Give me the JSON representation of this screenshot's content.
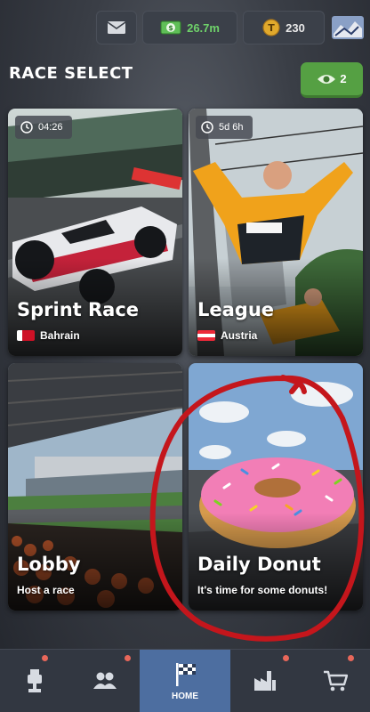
{
  "topbar": {
    "money": "26.7m",
    "gold": "230"
  },
  "header": {
    "title": "RACE SELECT",
    "viewers": "2"
  },
  "cards": [
    {
      "title": "Sprint Race",
      "subtitle": "Bahrain",
      "timer": "04:26"
    },
    {
      "title": "League",
      "subtitle": "Austria",
      "timer": "5d 6h"
    },
    {
      "title": "Lobby",
      "subtitle": "Host a race"
    },
    {
      "title": "Daily Donut",
      "subtitle": "It's time for some donuts!"
    }
  ],
  "nav": {
    "home_label": "HOME"
  },
  "colors": {
    "accent_green": "#55a043",
    "nav_active": "#4d6ea0",
    "notification_dot": "#e8675a",
    "annotation_circle": "#c4161c"
  }
}
